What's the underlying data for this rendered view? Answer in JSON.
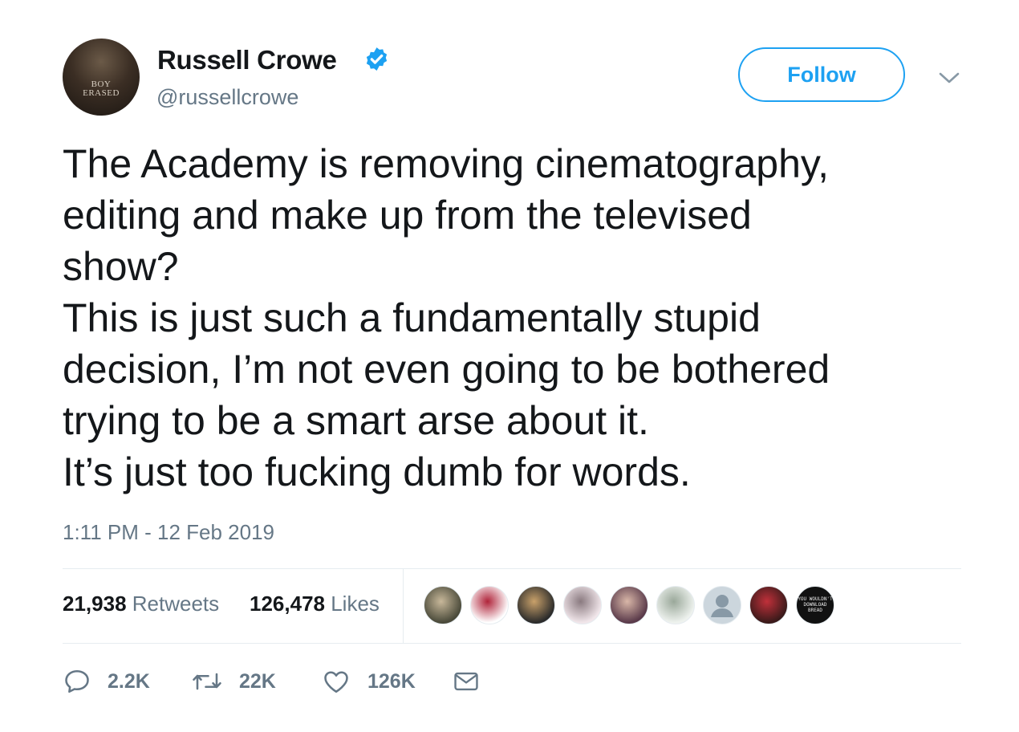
{
  "user": {
    "name": "Russell Crowe",
    "handle": "@russellcrowe",
    "avatar_text": [
      "BOY",
      "ERASED"
    ]
  },
  "follow_label": "Follow",
  "tweet": {
    "lines": [
      "The Academy is removing cinematography,",
      "editing and make up from the televised",
      "show?",
      "This is just such a fundamentally stupid",
      "decision, I’m not even going to be bothered",
      "trying to be a smart arse about it.",
      "It’s just too fucking dumb for words."
    ],
    "timestamp": "1:11 PM - 12 Feb 2019"
  },
  "stats": {
    "retweets_count": "21,938",
    "retweets_label": "Retweets",
    "likes_count": "126,478",
    "likes_label": "Likes"
  },
  "liker_avatars": [
    {
      "name": "liker-avatar-1",
      "colors": [
        "#4a4a3a",
        "#c8b89a"
      ]
    },
    {
      "name": "liker-avatar-2",
      "colors": [
        "#ffffff",
        "#b0243a"
      ]
    },
    {
      "name": "liker-avatar-3",
      "colors": [
        "#2b2b2b",
        "#c9a16a"
      ]
    },
    {
      "name": "liker-avatar-4",
      "colors": [
        "#f1e6ea",
        "#8a7a80"
      ]
    },
    {
      "name": "liker-avatar-5",
      "colors": [
        "#5a3a4a",
        "#d9b7a8"
      ]
    },
    {
      "name": "liker-avatar-6",
      "colors": [
        "#eef2ee",
        "#9aa89a"
      ]
    },
    {
      "name": "liker-avatar-7",
      "colors": [
        "#ccd6dd",
        "#8899a6"
      ]
    },
    {
      "name": "liker-avatar-8",
      "colors": [
        "#3a1a1a",
        "#c0303a"
      ]
    },
    {
      "name": "liker-avatar-9",
      "colors": [
        "#111111",
        "#e8e8e8"
      ]
    }
  ],
  "liker_texts": {
    "liker-avatar-9": [
      "YOU WOULDN'T",
      "DOWNLOAD",
      "BREAD"
    ]
  },
  "actions": {
    "reply_count": "2.2K",
    "retweet_count": "22K",
    "like_count": "126K"
  },
  "colors": {
    "accent": "#1da1f2",
    "text": "#14171a",
    "muted": "#657786",
    "divider": "#e6ecf0"
  },
  "icons": [
    "verified-badge-icon",
    "chevron-down-icon",
    "reply-icon",
    "retweet-icon",
    "heart-icon",
    "envelope-icon"
  ]
}
